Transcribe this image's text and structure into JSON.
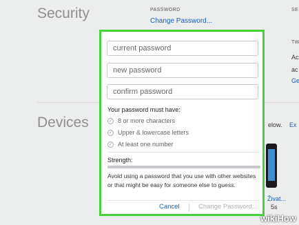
{
  "background": {
    "security_title": "Security",
    "devices_title": "Devices",
    "password_label": "PASSWORD",
    "change_password_link": "Change Password...",
    "right_label_top": "SE",
    "right_label_two": "TW",
    "right_frag_1": "Ac",
    "right_frag_2": "ac",
    "right_link": "Ge",
    "devices_partial_text": "elow.",
    "devices_partial_link": "Ex",
    "device_name": "Živat...",
    "device_model": "5s"
  },
  "dialog": {
    "fields": [
      {
        "placeholder": "current password",
        "value": ""
      },
      {
        "placeholder": "new password",
        "value": ""
      },
      {
        "placeholder": "confirm password",
        "value": ""
      }
    ],
    "requirements_title": "Your password must have:",
    "requirements": [
      "8 or more characters",
      "Upper & lowercase letters",
      "At least one number"
    ],
    "strength_label": "Strength:",
    "strength": 0,
    "note": "Avoid using a password that you use with other websites or that might be easy for someone else to guess.",
    "cancel_label": "Cancel",
    "change_label": "Change Password..."
  },
  "watermark": {
    "wiki": "wiki",
    "how": "How"
  },
  "colors": {
    "accent": "#1a5fb4",
    "highlight_border": "#46d234"
  }
}
